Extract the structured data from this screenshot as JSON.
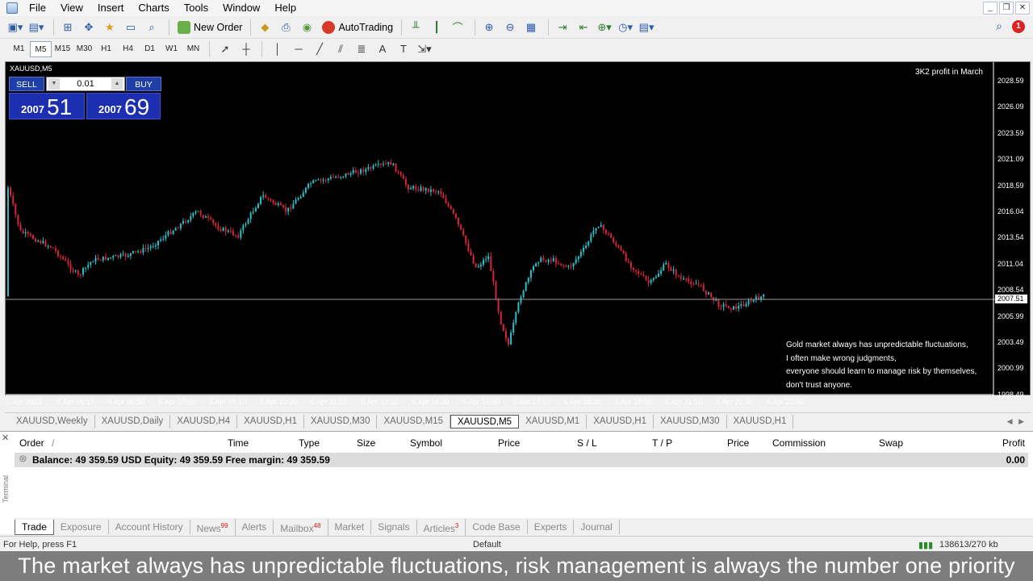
{
  "menu": {
    "items": [
      "File",
      "View",
      "Insert",
      "Charts",
      "Tools",
      "Window",
      "Help"
    ]
  },
  "toolbar": {
    "new_order_label": "New Order",
    "autotrading_label": "AutoTrading",
    "notification_count": "1"
  },
  "timeframes": [
    "M1",
    "M5",
    "M15",
    "M30",
    "H1",
    "H4",
    "D1",
    "W1",
    "MN"
  ],
  "active_timeframe": "M5",
  "chart": {
    "symbol_label": "XAUUSD,M5",
    "one_click": {
      "sell_label": "SELL",
      "buy_label": "BUY",
      "lot": "0.01",
      "sell_price_prefix": "2007",
      "sell_price_main": "51",
      "buy_price_prefix": "2007",
      "buy_price_main": "69"
    },
    "note_top": "3K2 profit in March",
    "note_lines": [
      "Gold market always has unpredictable fluctuations,",
      "I often make wrong judgments,",
      "everyone should learn to manage risk by themselves,",
      "don't trust anyone."
    ],
    "price_axis": [
      "2028.59",
      "2026.09",
      "2023.59",
      "2021.09",
      "2018.59",
      "2016.04",
      "2013.54",
      "2011.04",
      "2008.54",
      "2005.99",
      "2003.49",
      "2000.99",
      "1998.49"
    ],
    "current_price": "2007.51",
    "time_axis": [
      "6 Apr 2023",
      "6 Apr 05:10",
      "6 Apr 06:30",
      "6 Apr 07:50",
      "6 Apr 09:10",
      "6 Apr 10:30",
      "6 Apr 11:50",
      "6 Apr 13:10",
      "6 Apr 14:30",
      "6 Apr 15:50",
      "6 Apr 17:10",
      "6 Apr 18:30",
      "6 Apr 19:50",
      "6 Apr 21:10",
      "6 Apr 22:30",
      "6 Apr 23:50"
    ],
    "colors": {
      "up": "#27c0c8",
      "down": "#d8243a",
      "background": "#000000"
    }
  },
  "symbol_tabs": [
    "XAUUSD,Weekly",
    "XAUUSD,Daily",
    "XAUUSD,H4",
    "XAUUSD,H1",
    "XAUUSD,M30",
    "XAUUSD,M15",
    "XAUUSD,M5",
    "XAUUSD,M1",
    "XAUUSD,H1",
    "XAUUSD,M30",
    "XAUUSD,H1"
  ],
  "active_symbol_tab": 6,
  "terminal": {
    "columns": [
      "Order",
      "Time",
      "Type",
      "Size",
      "Symbol",
      "Price",
      "S / L",
      "T / P",
      "Price",
      "Commission",
      "Swap",
      "Profit"
    ],
    "balance_row": "Balance: 49 359.59 USD  Equity: 49 359.59  Free margin: 49 359.59",
    "balance_profit": "0.00",
    "side_label": "Terminal",
    "tabs": [
      {
        "label": "Trade",
        "badge": ""
      },
      {
        "label": "Exposure",
        "badge": ""
      },
      {
        "label": "Account History",
        "badge": ""
      },
      {
        "label": "News",
        "badge": "99"
      },
      {
        "label": "Alerts",
        "badge": ""
      },
      {
        "label": "Mailbox",
        "badge": "48"
      },
      {
        "label": "Market",
        "badge": ""
      },
      {
        "label": "Signals",
        "badge": ""
      },
      {
        "label": "Articles",
        "badge": "3"
      },
      {
        "label": "Code Base",
        "badge": ""
      },
      {
        "label": "Experts",
        "badge": ""
      },
      {
        "label": "Journal",
        "badge": ""
      }
    ]
  },
  "status": {
    "help": "For Help, press F1",
    "profile": "Default",
    "traffic": "138613/270 kb"
  },
  "caption": "The market always has unpredictable fluctuations, risk management is always the number one priority"
}
